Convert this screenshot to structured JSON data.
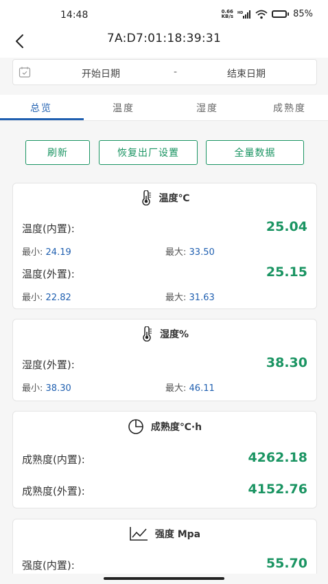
{
  "status": {
    "time": "14:48",
    "net_speed_top": "0.66",
    "net_speed_bottom": "KB/s",
    "battery": "85%",
    "battery_level": 0.85
  },
  "nav": {
    "title": "7A:D7:01:18:39:31"
  },
  "date_range": {
    "start": "开始日期",
    "separator": "-",
    "end": "结束日期"
  },
  "tabs": [
    {
      "label": "总览",
      "active": true
    },
    {
      "label": "温度",
      "active": false
    },
    {
      "label": "湿度",
      "active": false
    },
    {
      "label": "成熟度",
      "active": false
    }
  ],
  "actions": {
    "refresh": "刷新",
    "reset": "恢复出厂设置",
    "all_data": "全量数据"
  },
  "temperature": {
    "title": "温度℃",
    "internal_label": "温度(内置):",
    "internal_value": "25.04",
    "internal_min_label": "最小:",
    "internal_min": "24.19",
    "internal_max_label": "最大:",
    "internal_max": "33.50",
    "external_label": "温度(外置):",
    "external_value": "25.15",
    "external_min_label": "最小:",
    "external_min": "22.82",
    "external_max_label": "最大:",
    "external_max": "31.63"
  },
  "humidity": {
    "title": "湿度%",
    "external_label": "湿度(外置):",
    "external_value": "38.30",
    "min_label": "最小:",
    "min": "38.30",
    "max_label": "最大:",
    "max": "46.11"
  },
  "maturity": {
    "title": "成熟度℃·h",
    "internal_label": "成熟度(内置):",
    "internal_value": "4262.18",
    "external_label": "成熟度(外置):",
    "external_value": "4152.76"
  },
  "strength": {
    "title": "强度 Mpa",
    "internal_label": "强度(内置):",
    "internal_value": "55.70"
  },
  "colors": {
    "accent_green": "#1a9462",
    "accent_blue": "#1f5fb0"
  }
}
